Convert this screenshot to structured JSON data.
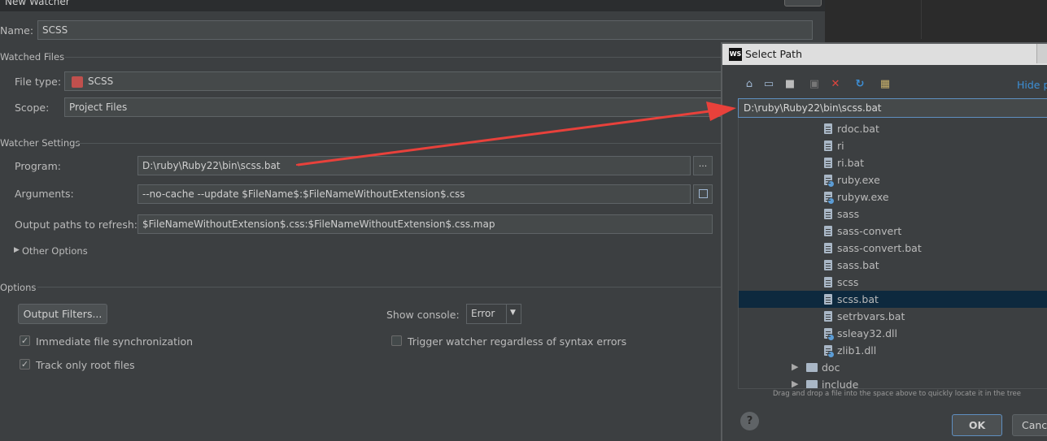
{
  "main_dialog": {
    "title": "New Watcher",
    "name_label": "Name:",
    "name_value": "SCSS",
    "watched_files_section": "Watched Files",
    "file_type_label": "File type:",
    "file_type_value": "SCSS",
    "scope_label": "Scope:",
    "scope_value": "Project Files",
    "watcher_settings_section": "Watcher Settings",
    "program_label": "Program:",
    "program_value": "D:\\ruby\\Ruby22\\bin\\scss.bat",
    "program_browse": "...",
    "arguments_label": "Arguments:",
    "arguments_value": "--no-cache --update $FileName$:$FileNameWithoutExtension$.css",
    "output_label": "Output paths to refresh:",
    "output_value": "$FileNameWithoutExtension$.css:$FileNameWithoutExtension$.css.map",
    "other_options": "Other Options",
    "options_section": "Options",
    "output_filters_button": "Output Filters...",
    "show_console_label": "Show console:",
    "show_console_value": "Error",
    "immediate_sync_label": "Immediate file synchronization",
    "immediate_sync_checked": true,
    "track_root_label": "Track only root files",
    "track_root_checked": true,
    "trigger_regardless_label": "Trigger watcher regardless of syntax errors",
    "trigger_regardless_checked": false
  },
  "select_path": {
    "title": "Select Path",
    "app_icon": "WS",
    "hide_path": "Hide p",
    "path_value": "D:\\ruby\\Ruby22\\bin\\scss.bat",
    "files": [
      {
        "name": "rdoc.bat",
        "icon": "file-icon"
      },
      {
        "name": "ri",
        "icon": "file-icon"
      },
      {
        "name": "ri.bat",
        "icon": "file-icon"
      },
      {
        "name": "ruby.exe",
        "icon": "exe-icon"
      },
      {
        "name": "rubyw.exe",
        "icon": "exe-icon"
      },
      {
        "name": "sass",
        "icon": "file-icon"
      },
      {
        "name": "sass-convert",
        "icon": "file-icon"
      },
      {
        "name": "sass-convert.bat",
        "icon": "file-icon"
      },
      {
        "name": "sass.bat",
        "icon": "file-icon"
      },
      {
        "name": "scss",
        "icon": "file-icon"
      },
      {
        "name": "scss.bat",
        "icon": "file-icon",
        "selected": true
      },
      {
        "name": "setrbvars.bat",
        "icon": "file-icon"
      },
      {
        "name": "ssleay32.dll",
        "icon": "exe-icon"
      },
      {
        "name": "zlib1.dll",
        "icon": "exe-icon"
      }
    ],
    "folders": [
      "doc",
      "include"
    ],
    "hint": "Drag and drop a file into the space above to quickly locate it in the tree",
    "ok_button": "OK",
    "cancel_button": "Cance",
    "help": "?"
  },
  "annotation_color": "#e8413b"
}
